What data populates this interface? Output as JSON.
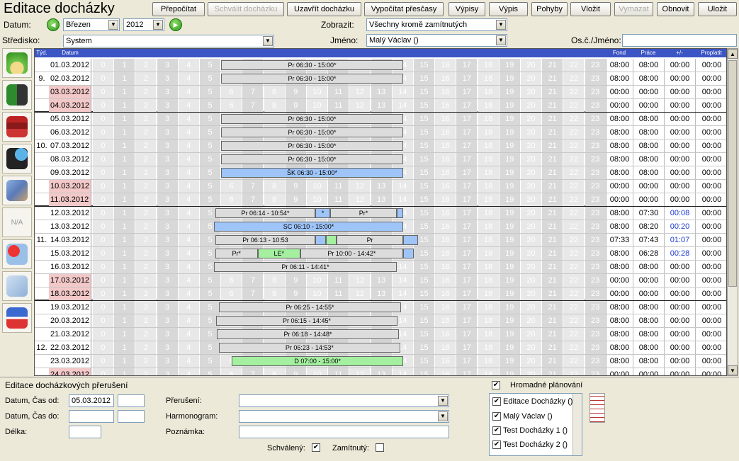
{
  "app": {
    "title": "Editace docházky"
  },
  "toolbar": [
    {
      "label": "Přepočítat",
      "enabled": true
    },
    {
      "label": "Schválit docházku",
      "enabled": false
    },
    {
      "label": "Uzavřít docházku",
      "enabled": true
    },
    {
      "label": "Vypočítat přesčasy",
      "enabled": true
    },
    {
      "label": "Výpisy",
      "enabled": true
    },
    {
      "label": "Výpis",
      "enabled": true
    },
    {
      "label": "Pohyby",
      "enabled": true
    },
    {
      "label": "Vložit",
      "enabled": true
    },
    {
      "label": "Vymazat",
      "enabled": false
    },
    {
      "label": "Obnovit",
      "enabled": true
    },
    {
      "label": "Uložit",
      "enabled": true
    }
  ],
  "filters": {
    "datum_label": "Datum:",
    "month": "Březen",
    "year": "2012",
    "stredisko_label": "Středisko:",
    "stredisko": "System",
    "zobrazit_label": "Zobrazit:",
    "zobrazit": "Všechny kromě zamítnutých",
    "jmeno_label": "Jméno:",
    "jmeno": "Malý Václav ()",
    "osc_label": "Os.č./Jméno:",
    "osc_value": ""
  },
  "grid": {
    "headers": {
      "week": "Týd.",
      "date": "Datum",
      "fond": "Fond",
      "prace": "Práce",
      "plusminus": "+/-",
      "proplatit": "Proplatit"
    },
    "hours": [
      "0",
      "1",
      "2",
      "3",
      "4",
      "5",
      "6",
      "7",
      "8",
      "9",
      "10",
      "11",
      "12",
      "13",
      "14",
      "15",
      "16",
      "17",
      "18",
      "19",
      "20",
      "21",
      "22",
      "23"
    ],
    "rows": [
      {
        "date": "01.03.2012",
        "week": "",
        "weekend": false,
        "fond": "08:00",
        "prace": "08:00",
        "pm": "00:00",
        "prop": "00:00",
        "bars": [
          {
            "start": 6.0,
            "end": 14.5,
            "label": "Pr 06:30 - 15:00*",
            "color": "#dcdcdc"
          }
        ]
      },
      {
        "date": "02.03.2012",
        "week": "9.",
        "weekend": false,
        "fond": "08:00",
        "prace": "08:00",
        "pm": "00:00",
        "prop": "00:00",
        "bars": [
          {
            "start": 6.0,
            "end": 14.5,
            "label": "Pr 06:30 - 15:00*",
            "color": "#dcdcdc"
          }
        ]
      },
      {
        "date": "03.03.2012",
        "week": "",
        "weekend": true,
        "fond": "00:00",
        "prace": "00:00",
        "pm": "00:00",
        "prop": "00:00",
        "bars": []
      },
      {
        "date": "04.03.2012",
        "week": "",
        "weekend": true,
        "fond": "00:00",
        "prace": "00:00",
        "pm": "00:00",
        "prop": "00:00",
        "bars": [],
        "sep": true
      },
      {
        "date": "05.03.2012",
        "week": "",
        "weekend": false,
        "fond": "08:00",
        "prace": "08:00",
        "pm": "00:00",
        "prop": "00:00",
        "bars": [
          {
            "start": 6.0,
            "end": 14.5,
            "label": "Pr 06:30 - 15:00*",
            "color": "#dcdcdc"
          }
        ]
      },
      {
        "date": "06.03.2012",
        "week": "",
        "weekend": false,
        "fond": "08:00",
        "prace": "08:00",
        "pm": "00:00",
        "prop": "00:00",
        "bars": [
          {
            "start": 6.0,
            "end": 14.5,
            "label": "Pr 06:30 - 15:00*",
            "color": "#dcdcdc"
          }
        ]
      },
      {
        "date": "07.03.2012",
        "week": "10.",
        "weekend": false,
        "fond": "08:00",
        "prace": "08:00",
        "pm": "00:00",
        "prop": "00:00",
        "bars": [
          {
            "start": 6.0,
            "end": 14.5,
            "label": "Pr 06:30 - 15:00*",
            "color": "#dcdcdc"
          }
        ]
      },
      {
        "date": "08.03.2012",
        "week": "",
        "weekend": false,
        "fond": "08:00",
        "prace": "08:00",
        "pm": "00:00",
        "prop": "00:00",
        "bars": [
          {
            "start": 6.0,
            "end": 14.5,
            "label": "Pr 06:30 - 15:00*",
            "color": "#dcdcdc"
          }
        ]
      },
      {
        "date": "09.03.2012",
        "week": "",
        "weekend": false,
        "fond": "08:00",
        "prace": "08:00",
        "pm": "00:00",
        "prop": "00:00",
        "bars": [
          {
            "start": 6.0,
            "end": 14.5,
            "label": "ŠK 06:30 - 15:00*",
            "color": "#9ec4f8"
          }
        ]
      },
      {
        "date": "10.03.2012",
        "week": "",
        "weekend": true,
        "fond": "00:00",
        "prace": "00:00",
        "pm": "00:00",
        "prop": "00:00",
        "bars": []
      },
      {
        "date": "11.03.2012",
        "week": "",
        "weekend": true,
        "fond": "00:00",
        "prace": "00:00",
        "pm": "00:00",
        "prop": "00:00",
        "bars": [],
        "sep": true
      },
      {
        "date": "12.03.2012",
        "week": "",
        "weekend": false,
        "fond": "08:00",
        "prace": "07:30",
        "pm": "00:08",
        "prop": "00:00",
        "pmblue": true,
        "bars": [
          {
            "start": 5.73,
            "end": 10.4,
            "label": "Pr 06:14 - 10:54*",
            "color": "#dcdcdc"
          },
          {
            "start": 10.4,
            "end": 11.1,
            "label": "*",
            "color": "#9ec4f8"
          },
          {
            "start": 11.1,
            "end": 14.2,
            "label": "Pr*",
            "color": "#dcdcdc"
          },
          {
            "start": 14.2,
            "end": 14.5,
            "label": "",
            "color": "#9ec4f8"
          }
        ]
      },
      {
        "date": "13.03.2012",
        "week": "",
        "weekend": false,
        "fond": "08:00",
        "prace": "08:20",
        "pm": "00:20",
        "prop": "00:00",
        "pmblue": true,
        "bars": [
          {
            "start": 5.67,
            "end": 14.5,
            "label": "SC 06:10 - 15:00*",
            "color": "#9ec4f8"
          }
        ]
      },
      {
        "date": "14.03.2012",
        "week": "11.",
        "weekend": false,
        "fond": "07:33",
        "prace": "07:43",
        "pm": "01:07",
        "prop": "00:00",
        "pmblue": true,
        "bars": [
          {
            "start": 5.73,
            "end": 10.4,
            "label": "Pr 06:13 - 10:53",
            "color": "#dcdcdc"
          },
          {
            "start": 10.4,
            "end": 10.9,
            "label": "",
            "color": "#9ec4f8"
          },
          {
            "start": 10.9,
            "end": 11.4,
            "label": "",
            "color": "#a4f0a0"
          },
          {
            "start": 11.4,
            "end": 14.5,
            "label": "Pr",
            "color": "#dcdcdc"
          },
          {
            "start": 14.5,
            "end": 15.2,
            "label": "",
            "color": "#9ec4f8"
          }
        ]
      },
      {
        "date": "15.03.2012",
        "week": "",
        "weekend": false,
        "fond": "08:00",
        "prace": "06:28",
        "pm": "00:28",
        "prop": "00:00",
        "pmblue": true,
        "bars": [
          {
            "start": 5.73,
            "end": 7.7,
            "label": "Pr*",
            "color": "#dcdcdc"
          },
          {
            "start": 7.7,
            "end": 9.7,
            "label": "LE*",
            "color": "#a4f0a0"
          },
          {
            "start": 9.7,
            "end": 14.5,
            "label": "Pr 10:00 - 14:42*",
            "color": "#dcdcdc"
          },
          {
            "start": 14.5,
            "end": 15.0,
            "label": "",
            "color": "#9ec4f8"
          }
        ]
      },
      {
        "date": "16.03.2012",
        "week": "",
        "weekend": false,
        "fond": "08:00",
        "prace": "08:00",
        "pm": "00:00",
        "prop": "00:00",
        "bars": [
          {
            "start": 5.67,
            "end": 14.2,
            "label": "Pr 06:11 - 14:41*",
            "color": "#dcdcdc"
          }
        ]
      },
      {
        "date": "17.03.2012",
        "week": "",
        "weekend": true,
        "fond": "00:00",
        "prace": "00:00",
        "pm": "00:00",
        "prop": "00:00",
        "bars": []
      },
      {
        "date": "18.03.2012",
        "week": "",
        "weekend": true,
        "fond": "00:00",
        "prace": "00:00",
        "pm": "00:00",
        "prop": "00:00",
        "bars": [],
        "sep": true
      },
      {
        "date": "19.03.2012",
        "week": "",
        "weekend": false,
        "fond": "08:00",
        "prace": "08:00",
        "pm": "00:00",
        "prop": "00:00",
        "bars": [
          {
            "start": 5.9,
            "end": 14.4,
            "label": "Pr 06:25 - 14:55*",
            "color": "#dcdcdc"
          }
        ]
      },
      {
        "date": "20.03.2012",
        "week": "",
        "weekend": false,
        "fond": "08:00",
        "prace": "08:00",
        "pm": "00:00",
        "prop": "00:00",
        "bars": [
          {
            "start": 5.75,
            "end": 14.25,
            "label": "Pr 06:15 - 14:45*",
            "color": "#dcdcdc"
          }
        ]
      },
      {
        "date": "21.03.2012",
        "week": "",
        "weekend": false,
        "fond": "08:00",
        "prace": "08:00",
        "pm": "00:00",
        "prop": "00:00",
        "bars": [
          {
            "start": 5.8,
            "end": 14.3,
            "label": "Pr 06:18 - 14:48*",
            "color": "#dcdcdc"
          }
        ]
      },
      {
        "date": "22.03.2012",
        "week": "12.",
        "weekend": false,
        "fond": "08:00",
        "prace": "08:00",
        "pm": "00:00",
        "prop": "00:00",
        "bars": [
          {
            "start": 5.88,
            "end": 14.38,
            "label": "Pr 06:23 - 14:53*",
            "color": "#dcdcdc"
          }
        ]
      },
      {
        "date": "23.03.2012",
        "week": "",
        "weekend": false,
        "fond": "08:00",
        "prace": "08:00",
        "pm": "00:00",
        "prop": "00:00",
        "bars": [
          {
            "start": 6.5,
            "end": 14.5,
            "label": "D 07:00 - 15:00*",
            "color": "#a4f0a0"
          }
        ]
      },
      {
        "date": "24.03.2012",
        "week": "",
        "weekend": true,
        "fond": "00:00",
        "prace": "00:00",
        "pm": "00:00",
        "prop": "00:00",
        "bars": []
      }
    ]
  },
  "bottom": {
    "title": "Editace docházkových přerušení",
    "datum_od_label": "Datum, Čas od:",
    "datum_od": "05.03.2012",
    "cas_od": "",
    "datum_do_label": "Datum, Čas do:",
    "datum_do": "",
    "cas_do": "",
    "delka_label": "Délka:",
    "delka": "",
    "preruseni_label": "Přerušení:",
    "preruseni": "",
    "harmonogram_label": "Harmonogram:",
    "harmonogram": "",
    "poznamka_label": "Poznámka:",
    "poznamka": "",
    "schvaleny_label": "Schválený:",
    "schvaleny": true,
    "zamitnuty_label": "Zamítnutý:",
    "zamitnuty": false,
    "hromadne_label": "Hromadné plánování",
    "hromadne": true,
    "list": [
      {
        "label": "Editace Docházky ()",
        "checked": true
      },
      {
        "label": "Malý Václav ()",
        "checked": true
      },
      {
        "label": "Test Docházky 1 ()",
        "checked": true
      },
      {
        "label": "Test Docházky 2 ()",
        "checked": true
      }
    ]
  },
  "colors": {
    "header": "#3c55c4",
    "weekend": "#f3c8c8",
    "bar_grey": "#dcdcdc",
    "bar_blue": "#9ec4f8",
    "bar_green": "#a4f0a0"
  }
}
